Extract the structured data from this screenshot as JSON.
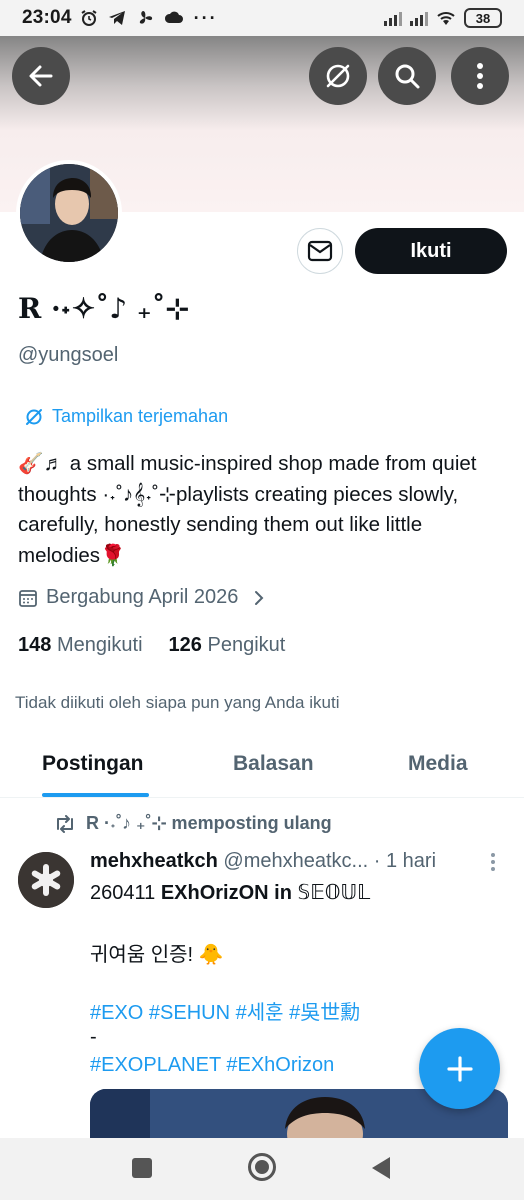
{
  "status_bar": {
    "time": "23:04",
    "left_icons": [
      "alarm-icon",
      "telegram-icon",
      "fan-icon",
      "cloud-icon",
      "more-dots-icon"
    ],
    "more_dots": "···",
    "battery": "38"
  },
  "header": {
    "back_icon": "arrow-left-icon",
    "translate_icon": "translate-off-icon",
    "search_icon": "search-icon",
    "more_icon": "more-vertical-icon"
  },
  "profile": {
    "display_name": "R ·˖✧˚♪ ₊˚⊹",
    "handle": "@yungsoel",
    "follow_label": "Ikuti",
    "translate_label": "Tampilkan terjemahan",
    "bio": "🎸♬ a small music-inspired shop made from quiet thoughts ·˖˚♪𝄞˖˚⊹playlists creating pieces slowly, carefully, honestly sending them out like little melodies🌹",
    "joined": "Bergabung April 2026",
    "following_count": "148",
    "following_label": "Mengikuti",
    "followers_count": "126",
    "followers_label": "Pengikut",
    "not_followed_text": "Tidak diikuti oleh siapa pun yang Anda ikuti"
  },
  "tabs": [
    {
      "label": "Postingan",
      "active": true
    },
    {
      "label": "Balasan",
      "active": false
    },
    {
      "label": "Media",
      "active": false
    }
  ],
  "post": {
    "repost_text": "R ·˖˚♪ ₊˚⊹ memposting ulang",
    "author_name": "mehxheatkch",
    "author_handle": "@mehxheatkc...",
    "time": "· 1 hari",
    "line1_prefix": "260411 ",
    "line1_bold": "EXhOrizON in ",
    "line1_seoul": "𝕊𝔼𝕆𝕌𝕃",
    "line2": "귀여움 인증! 🐥",
    "hashtags_line1": "#EXO #SEHUN #세훈 #吳世勳",
    "dash": "-",
    "hashtags_line2": "#EXOPLANET #EXhOrizon"
  },
  "fab_icon": "plus-icon",
  "nav": [
    "recents-square-icon",
    "home-circle-icon",
    "back-triangle-icon"
  ],
  "colors": {
    "accent": "#1d9bf0",
    "text_primary": "#0f1419",
    "text_secondary": "#536471",
    "follow_button": "#0f1419"
  }
}
